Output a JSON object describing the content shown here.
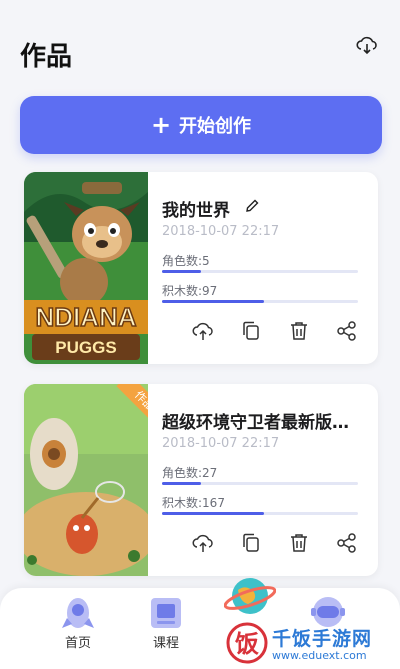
{
  "header": {
    "title": "作品",
    "cloud_icon": "cloud-download-icon"
  },
  "create_button": {
    "label": "开始创作",
    "icon": "plus-icon",
    "color": "#5d6ef2"
  },
  "works": [
    {
      "title": "我的世界",
      "date": "2018-10-07 22:17",
      "roles_label": "角色数:5",
      "roles_value": 5,
      "roles_fill": 0.2,
      "blocks_label": "积木数:97",
      "blocks_value": 97,
      "blocks_fill": 0.52,
      "thumb_text_top": "NDIANA",
      "thumb_text_bottom": "PUGGS",
      "tag": ""
    },
    {
      "title": "超级环境守卫者最新版…",
      "date": "2018-10-07 22:17",
      "roles_label": "角色数:27",
      "roles_value": 27,
      "roles_fill": 0.2,
      "blocks_label": "积木数:167",
      "blocks_value": 167,
      "blocks_fill": 0.52,
      "tag": "作品"
    }
  ],
  "card_actions": [
    "upload-cloud-icon",
    "copy-icon",
    "trash-icon",
    "share-icon"
  ],
  "tabbar": {
    "tabs": [
      {
        "label": "首页",
        "icon": "rocket-icon"
      },
      {
        "label": "课程",
        "icon": "course-icon"
      },
      {
        "label": "",
        "icon": "planet-icon"
      },
      {
        "label": "",
        "icon": "astronaut-icon"
      }
    ]
  },
  "watermark": {
    "title": "千饭手游网",
    "url": "www.eduext.com"
  },
  "colors": {
    "accent": "#5d6ef2",
    "progress": "#4e5ee8",
    "tag": "#f4a340",
    "watermark": "#2d7ad6"
  }
}
